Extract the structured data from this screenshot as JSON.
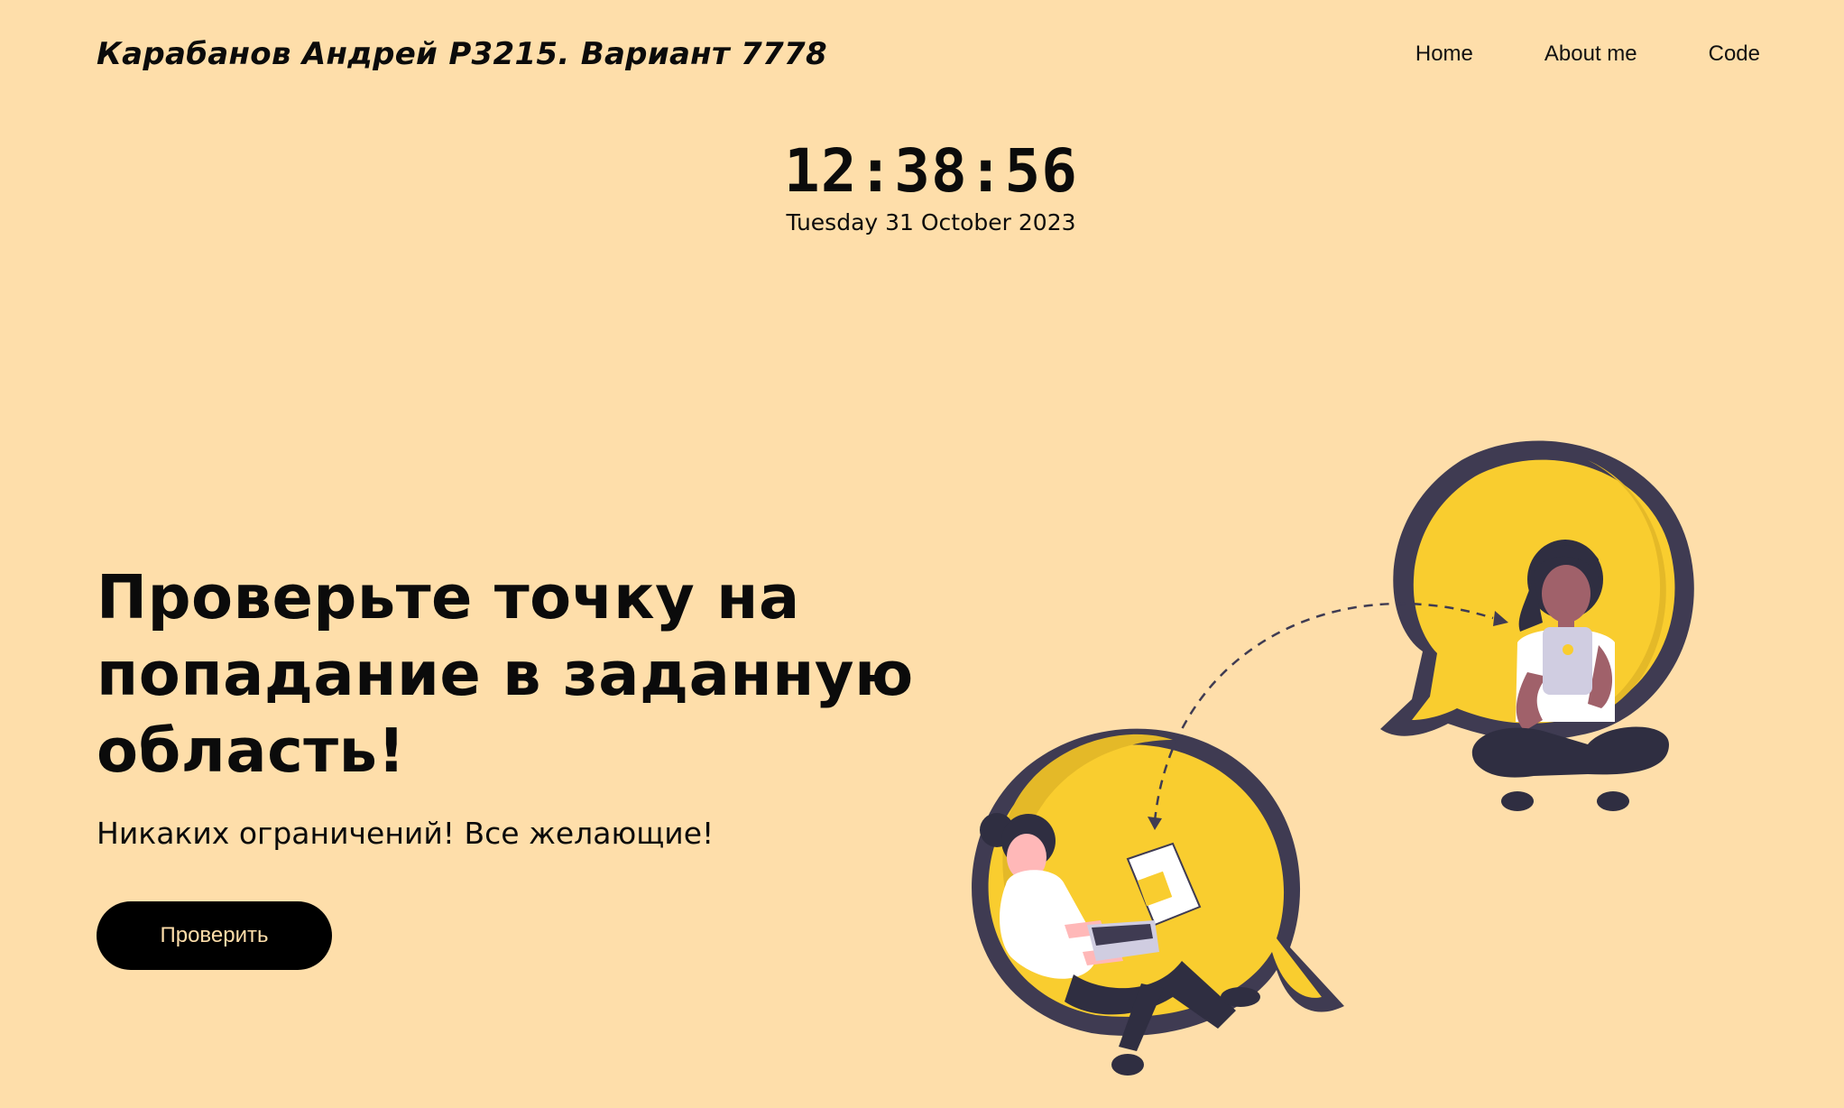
{
  "header": {
    "brand": "Карабанов Андрей P3215. Вариант 7778",
    "nav": [
      "Home",
      "About me",
      "Code"
    ]
  },
  "clock": {
    "time": "12:38:56",
    "date": "Tuesday 31 October 2023"
  },
  "hero": {
    "title": "Проверьте точку на попадание в заданную область!",
    "subtitle": "Никаких ограничений! Все желающие!",
    "button": "Проверить"
  },
  "colors": {
    "background": "#fedeaa",
    "bubble": "#f9cd2f",
    "bubble_shadow": "#e4b928",
    "outline": "#3f3b52",
    "button_bg": "#000000",
    "button_text": "#fedeaa"
  },
  "illustration": {
    "name": "two-people-chat-illustration"
  }
}
